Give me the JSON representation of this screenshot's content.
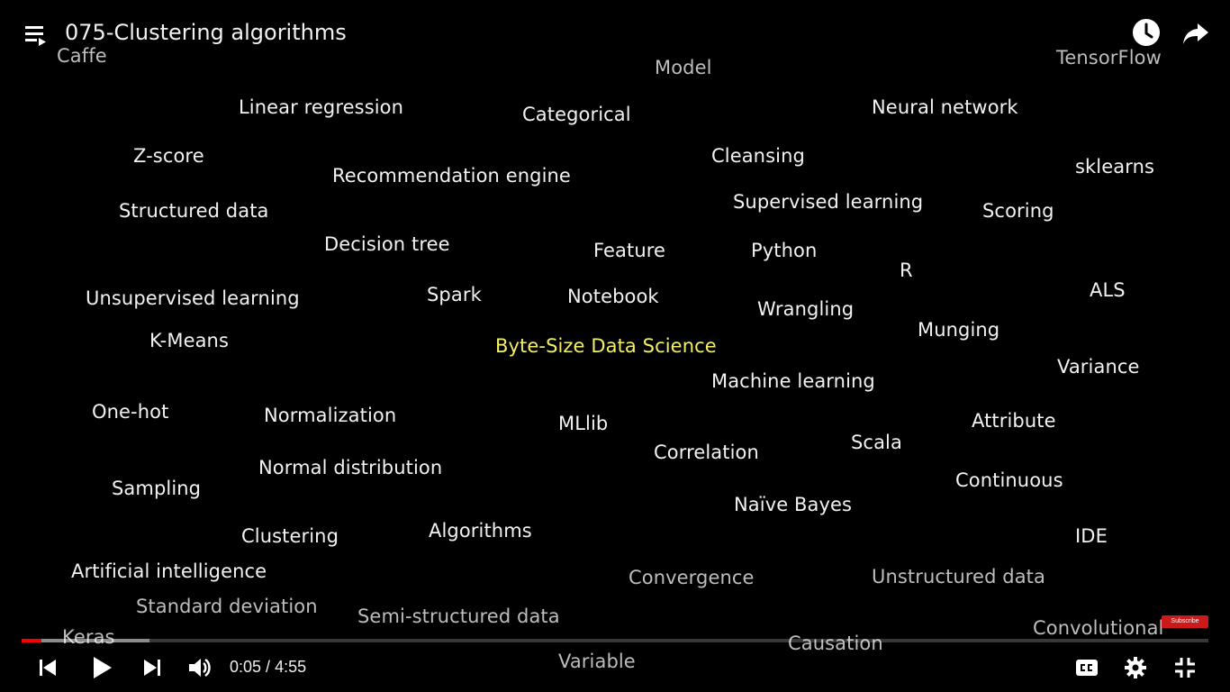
{
  "video": {
    "title": "075-Clustering algorithms",
    "current_time": "0:05",
    "duration": "4:55",
    "time_separator": " / ",
    "progress_fraction": 0.0167,
    "buffered_fraction": 0.108,
    "progress_color": "#ff0000"
  },
  "icons": {
    "playlist": "playlist-icon",
    "watch_later": "clock-icon",
    "share": "share-icon",
    "previous": "skip-previous-icon",
    "play": "play-icon",
    "next": "skip-next-icon",
    "volume": "volume-icon",
    "captions": "captions-icon",
    "settings": "gear-icon",
    "fullscreen_exit": "exit-fullscreen-icon"
  },
  "subscribe_badge": "Subscribe",
  "words": {
    "caffe": "Caffe",
    "model": "Model",
    "tensorflow": "TensorFlow",
    "linear_regression": "Linear regression",
    "categorical": "Categorical",
    "neural_network": "Neural network",
    "z_score": "Z-score",
    "cleansing": "Cleansing",
    "sklearns": "sklearns",
    "recommendation_engine": "Recommendation engine",
    "supervised_learning": "Supervised learning",
    "structured_data": "Structured data",
    "scoring": "Scoring",
    "decision_tree": "Decision tree",
    "feature": "Feature",
    "python": "Python",
    "r": "R",
    "unsupervised_learning": "Unsupervised learning",
    "spark": "Spark",
    "notebook": "Notebook",
    "als": "ALS",
    "wrangling": "Wrangling",
    "munging": "Munging",
    "k_means": "K-Means",
    "byte_size": "Byte-Size Data Science",
    "variance": "Variance",
    "machine_learning": "Machine learning",
    "one_hot": "One-hot",
    "normalization": "Normalization",
    "mllib": "MLlib",
    "attribute": "Attribute",
    "scala": "Scala",
    "correlation": "Correlation",
    "normal_distribution": "Normal distribution",
    "continuous": "Continuous",
    "sampling": "Sampling",
    "naive_bayes": "Naïve Bayes",
    "clustering": "Clustering",
    "algorithms": "Algorithms",
    "ide": "IDE",
    "artificial_intelligence": "Artificial intelligence",
    "convergence": "Convergence",
    "unstructured_data": "Unstructured data",
    "standard_deviation": "Standard deviation",
    "semi_structured_data": "Semi-structured data",
    "convolutional": "Convolutional",
    "keras": "Keras",
    "causation": "Causation",
    "variable": "Variable"
  },
  "colors": {
    "background": "#000000",
    "word": "#f2f2f2",
    "word_dim": "#bdbdbd",
    "highlight": "#f3ef67"
  }
}
